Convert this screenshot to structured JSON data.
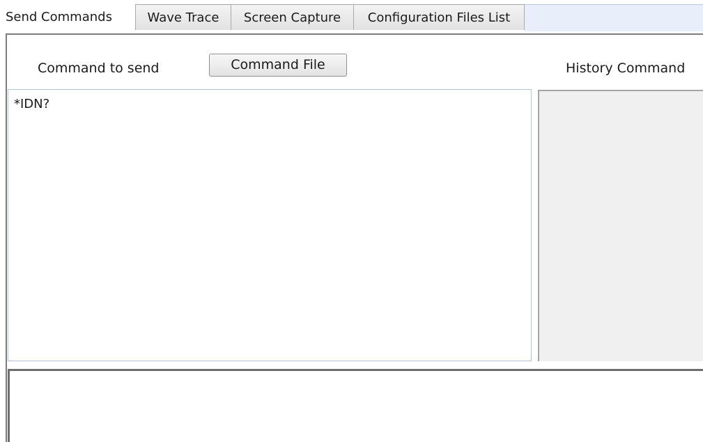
{
  "tabs": {
    "send_commands": "Send Commands",
    "wave_trace": "Wave Trace",
    "screen_capture": "Screen Capture",
    "configuration_files_list": "Configuration Files List"
  },
  "send_panel": {
    "command_label": "Command to send",
    "command_file_button": "Command File",
    "history_label": "History Command",
    "command_value": "*IDN?",
    "history_items": [],
    "output_text": ""
  }
}
